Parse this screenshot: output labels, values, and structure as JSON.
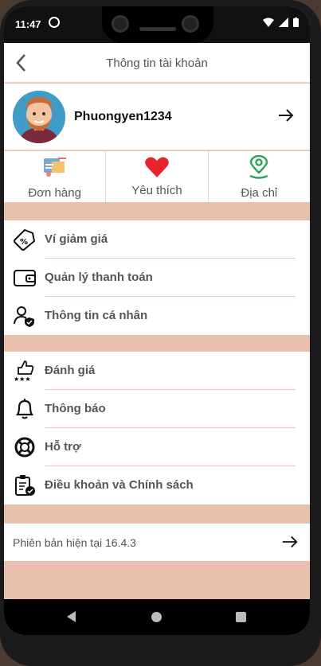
{
  "status": {
    "time": "11:47"
  },
  "header": {
    "title": "Thông tin tài khoản"
  },
  "profile": {
    "username": "Phuongyen1234"
  },
  "quick_actions": [
    {
      "label": "Đơn hàng",
      "icon": "orders-icon"
    },
    {
      "label": "Yêu thích",
      "icon": "heart-icon",
      "color": "#e8242b"
    },
    {
      "label": "Địa chỉ",
      "icon": "location-pin-icon",
      "color": "#2fa560"
    }
  ],
  "menu_group_1": [
    {
      "label": "Ví giảm giá",
      "icon": "discount-tag-icon"
    },
    {
      "label": "Quản lý thanh toán",
      "icon": "wallet-icon"
    },
    {
      "label": "Thông tin cá nhân",
      "icon": "user-shield-icon"
    }
  ],
  "menu_group_2": [
    {
      "label": "Đánh giá",
      "icon": "thumbs-up-stars-icon"
    },
    {
      "label": "Thông báo",
      "icon": "bell-icon"
    },
    {
      "label": "Hỗ trợ",
      "icon": "lifebuoy-icon"
    },
    {
      "label": "Điều khoản và Chính sách",
      "icon": "clipboard-check-icon"
    }
  ],
  "version": {
    "label": "Phiên bản hiện tại 16.4.3"
  },
  "colors": {
    "accent_band": "#e9bfae",
    "divider": "#f0c8b4"
  }
}
